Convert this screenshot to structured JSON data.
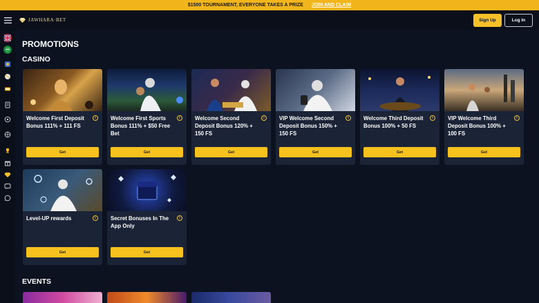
{
  "banner": {
    "text": "$1500 TOURNAMENT, EVERYONE TAKES A PRIZE",
    "link": "JOIN AND CLAIM"
  },
  "header": {
    "logo": "JAWHARA·BET",
    "signup": "Sign Up",
    "login": "Log In"
  },
  "sidebar": {
    "items": [
      {
        "icon": "uk-flag-icon"
      },
      {
        "icon": "globe-icon"
      },
      {
        "icon": "casino-icon"
      },
      {
        "icon": "sports-icon"
      },
      {
        "icon": "ticket-icon"
      },
      {
        "icon": "list-icon"
      },
      {
        "icon": "roulette-icon"
      },
      {
        "icon": "ball-icon"
      },
      {
        "icon": "trophy-icon"
      },
      {
        "icon": "gift-icon"
      },
      {
        "icon": "diamond-icon"
      },
      {
        "icon": "chat-icon"
      },
      {
        "icon": "whatsapp-icon"
      }
    ]
  },
  "page": {
    "title": "PROMOTIONS",
    "casino_heading": "CASINO",
    "events_heading": "EVENTS"
  },
  "promotions": [
    {
      "title": "Welcome First Deposit Bonus 111% + 111 FS",
      "button": "Get",
      "info": "i"
    },
    {
      "title": "Welcome First Sports Bonus 111% + $50 Free Bet",
      "button": "Get",
      "info": "i"
    },
    {
      "title": "Welcome Second Deposit Bonus 120% + 150 FS",
      "button": "Get",
      "info": "i"
    },
    {
      "title": "VIP Welcome Second Deposit Bonus 150% + 150 FS",
      "button": "Get",
      "info": "i"
    },
    {
      "title": "Welcome Third Deposit Bonus 100% + 50 FS",
      "button": "Get",
      "info": "i"
    },
    {
      "title": "VIP Welcome Third Deposit Bonus 100% + 100 FS",
      "button": "Get",
      "info": "i"
    },
    {
      "title": "Level-UP rewards",
      "button": "Get",
      "info": "i"
    },
    {
      "title": "Secret Bonuses  In The App Only",
      "button": "Get",
      "info": "i"
    }
  ],
  "colors": {
    "accent": "#f5c028",
    "card_bg": "#1b2336",
    "page_bg": "#0d1220"
  }
}
